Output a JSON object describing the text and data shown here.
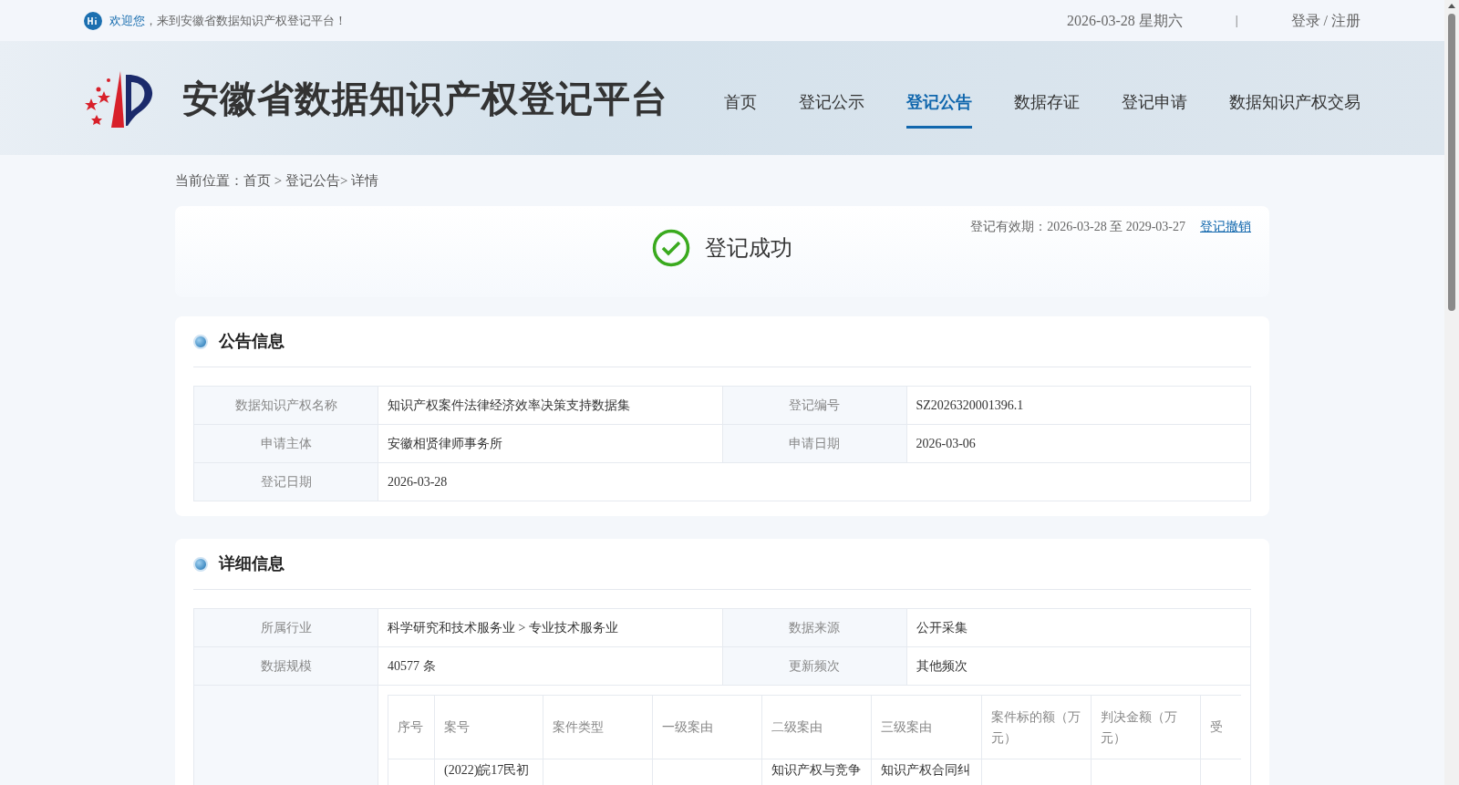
{
  "top_bar": {
    "greeting": "欢迎您",
    "welcome": "，来到安徽省数据知识产权登记平台！",
    "date": "2026-03-28 星期六",
    "separator": "|",
    "login": "登录 / 注册"
  },
  "header": {
    "site_title": "安徽省数据知识产权登记平台",
    "nav": [
      {
        "label": "首页",
        "selected": false
      },
      {
        "label": "登记公示",
        "selected": false
      },
      {
        "label": "登记公告",
        "selected": true
      },
      {
        "label": "数据存证",
        "selected": false
      },
      {
        "label": "登记申请",
        "selected": false
      },
      {
        "label": "数据知识产权交易",
        "selected": false
      }
    ]
  },
  "breadcrumb": "当前位置：首页 > 登记公告> 详情",
  "status_card": {
    "status": "登记成功",
    "validity": "登记有效期：2026-03-28 至 2029-03-27",
    "revoke_link": "登记撤销"
  },
  "announcement": {
    "title": "公告信息",
    "rows": [
      [
        {
          "label": "数据知识产权名称",
          "value": "知识产权案件法律经济效率决策支持数据集"
        },
        {
          "label": "登记编号",
          "value": "SZ2026320001396.1"
        }
      ],
      [
        {
          "label": "申请主体",
          "value": "安徽相贤律师事务所"
        },
        {
          "label": "申请日期",
          "value": "2026-03-06"
        }
      ],
      [
        {
          "label": "登记日期",
          "value": "2026-03-28"
        }
      ]
    ]
  },
  "details": {
    "title": "详细信息",
    "rows": [
      [
        {
          "label": "所属行业",
          "value": "科学研究和技术服务业 > 专业技术服务业"
        },
        {
          "label": "数据来源",
          "value": "公开采集"
        }
      ],
      [
        {
          "label": "数据规模",
          "value": "40577 条"
        },
        {
          "label": "更新频次",
          "value": "其他频次"
        }
      ]
    ],
    "sample_table": {
      "columns": [
        "序号",
        "案号",
        "案件类型",
        "一级案由",
        "二级案由",
        "三级案由",
        "案件标的额（万元）",
        "判决金额（万元）",
        "受"
      ],
      "rows": [
        [
          "",
          "(2022)皖17民初",
          "",
          "",
          "知识产权与竞争",
          "知识产权合同纠",
          "",
          "",
          ""
        ]
      ]
    }
  }
}
